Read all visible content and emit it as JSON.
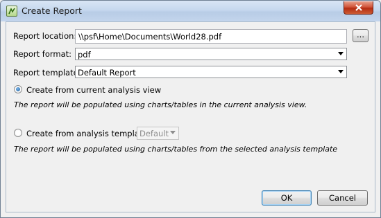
{
  "window": {
    "title": "Create Report"
  },
  "fields": {
    "location_label": "Report location:",
    "location_value": "\\\\psf\\Home\\Documents\\World28.pdf",
    "browse_label": "...",
    "format_label": "Report format:",
    "format_value": "pdf",
    "template_label": "Report template:",
    "template_value": "Default Report"
  },
  "options": {
    "current_view_label": "Create from current analysis view",
    "current_view_desc": "The report will be populated using charts/tables in the current analysis view.",
    "current_view_selected": true,
    "template_option_label": "Create from analysis template:",
    "template_option_value": "Default",
    "template_option_desc": "The report will be populated using charts/tables from the selected analysis template",
    "template_option_selected": false
  },
  "buttons": {
    "ok": "OK",
    "cancel": "Cancel"
  }
}
